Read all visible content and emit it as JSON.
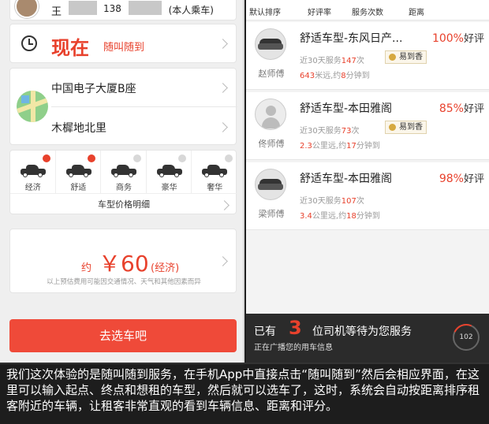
{
  "left_screen": {
    "top_card": {
      "name": "王",
      "phone_prefix": "138",
      "tag": "(本人乘车)"
    },
    "time": {
      "label": "现在",
      "sub": "随叫随到"
    },
    "route": {
      "from": "中国电子大厦B座",
      "to": "木樨地北里"
    },
    "car_types": [
      {
        "name": "经济",
        "selected": true
      },
      {
        "name": "舒适",
        "selected": true
      },
      {
        "name": "商务",
        "selected": false
      },
      {
        "name": "豪华",
        "selected": false
      },
      {
        "name": "奢华",
        "selected": false
      }
    ],
    "price_detail_label": "车型价格明细",
    "estimate": {
      "prefix": "约",
      "price": "￥60",
      "type": "(经济)",
      "note": "以上预估费用可能因交通情况、天气和其他因素而异"
    },
    "go_button": "去选车吧"
  },
  "right_screen": {
    "sort_tabs": [
      "默认排序",
      "好评率",
      "服务次数",
      "距离"
    ],
    "drivers": [
      {
        "name": "赵师傅",
        "car": "舒适车型-东风日产...",
        "rate": "100%",
        "rate_suffix": "好评",
        "service_prefix": "近30天服务",
        "service_count": "147",
        "service_suffix": "次",
        "badge": "易到香",
        "distance": "643",
        "distance_text": "米远,约",
        "minutes": "8",
        "minutes_suffix": "分钟到",
        "avatar": "car-photo"
      },
      {
        "name": "佟师傅",
        "car": "舒适车型-本田雅阁",
        "rate": "85%",
        "rate_suffix": "好评",
        "service_prefix": "近30天服务",
        "service_count": "73",
        "service_suffix": "次",
        "badge": "易到香",
        "distance": "2.3",
        "distance_text": "公里远,约",
        "minutes": "17",
        "minutes_suffix": "分钟到",
        "avatar": "placeholder-person"
      },
      {
        "name": "梁师傅",
        "car": "舒适车型-本田雅阁",
        "rate": "98%",
        "rate_suffix": "好评",
        "service_prefix": "近30天服务",
        "service_count": "107",
        "service_suffix": "次",
        "badge": "",
        "distance": "3.4",
        "distance_text": "公里远,约",
        "minutes": "18",
        "minutes_suffix": "分钟到",
        "avatar": "car-photo"
      }
    ],
    "wait_bar": {
      "prefix": "已有",
      "count": "3",
      "suffix": "位司机等待为您服务",
      "sub": "正在广播您的用车信息",
      "timer": "102"
    }
  },
  "caption": "我们这次体验的是随叫随到服务，在手机App中直接点击“随叫随到”然后会相应界面，在这里可以输入起点、终点和想租的车型，然后就可以选车了，这时，系统会自动按距离排序租客附近的车辆，让租客非常直观的看到车辆信息、距离和评分。",
  "colors": {
    "accent": "#e8412c",
    "button": "#ef4a39"
  }
}
